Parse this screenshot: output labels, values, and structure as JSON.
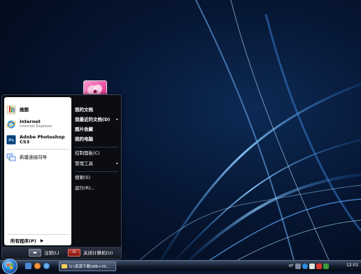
{
  "start_menu": {
    "left_items": [
      {
        "title": "画图",
        "subtitle": ""
      },
      {
        "title": "Internet",
        "subtitle": "Internet Explorer"
      },
      {
        "title": "Adobe Photoshop CS3",
        "subtitle": ""
      },
      {
        "title": "新建连接向导",
        "subtitle": ""
      }
    ],
    "all_programs": "所有程序(P)",
    "right_items": [
      {
        "label": "我的文档",
        "submenu": ""
      },
      {
        "label": "我最近的文档(D)",
        "submenu": "▸"
      },
      {
        "label": "图片收藏",
        "submenu": ""
      },
      {
        "label": "我的电脑",
        "submenu": ""
      },
      {
        "label": "控制面板(C)",
        "submenu": ""
      },
      {
        "label": "管理工具",
        "submenu": "▸"
      },
      {
        "label": "搜索(S)",
        "submenu": ""
      },
      {
        "label": "运行(R)...",
        "submenu": ""
      }
    ],
    "logoff_label": "注销(L)",
    "shutdown_label": "关闭计算机(U)"
  },
  "taskbar": {
    "task_button_label": "G:\\资源下载\\WB+VS...",
    "tray_lang": "KF",
    "clock": "12:01"
  },
  "colors": {
    "accent": "#2c7cd1",
    "shutdown": "#c0443a",
    "desktop_dark": "#020814"
  }
}
